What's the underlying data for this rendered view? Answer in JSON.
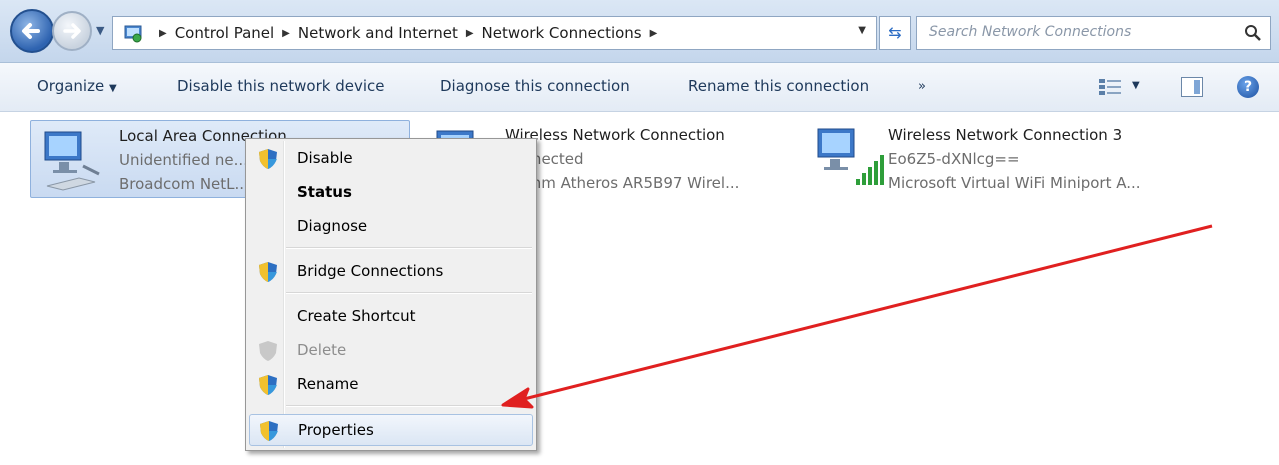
{
  "address_bar": {
    "breadcrumbs": [
      "Control Panel",
      "Network and Internet",
      "Network Connections"
    ],
    "search_placeholder": "Search Network Connections"
  },
  "toolbar": {
    "organize_label": "Organize",
    "disable_label": "Disable this network device",
    "diagnose_label": "Diagnose this connection",
    "rename_label": "Rename this connection",
    "more_label": "»"
  },
  "connections": [
    {
      "name": "Local Area Connection",
      "status": "Unidentified ne...",
      "device": "Broadcom NetL...",
      "icon": "wired-network-icon",
      "selected": true
    },
    {
      "name": "Wireless Network Connection",
      "status": "connected",
      "device": "lcomm Atheros AR5B97 Wirel...",
      "icon": "wireless-network-icon"
    },
    {
      "name": "Wireless Network Connection 3",
      "status": "Eo6Z5-dXNlcg==",
      "device": "Microsoft Virtual WiFi Miniport A...",
      "icon": "wireless-signal-icon"
    }
  ],
  "context_menu": {
    "items": [
      {
        "label": "Disable",
        "icon": "shield-icon"
      },
      {
        "label": "Status",
        "bold": true
      },
      {
        "label": "Diagnose"
      },
      {
        "label": "Bridge Connections",
        "icon": "shield-icon"
      },
      {
        "label": "Create Shortcut"
      },
      {
        "label": "Delete",
        "icon": "shield-icon",
        "disabled": true
      },
      {
        "label": "Rename",
        "icon": "shield-icon"
      },
      {
        "label": "Properties",
        "icon": "shield-icon",
        "highlighted": true
      }
    ]
  },
  "colors": {
    "annotation_arrow": "#e02020",
    "selection": "#cfdef3",
    "accent": "#1e395b"
  }
}
